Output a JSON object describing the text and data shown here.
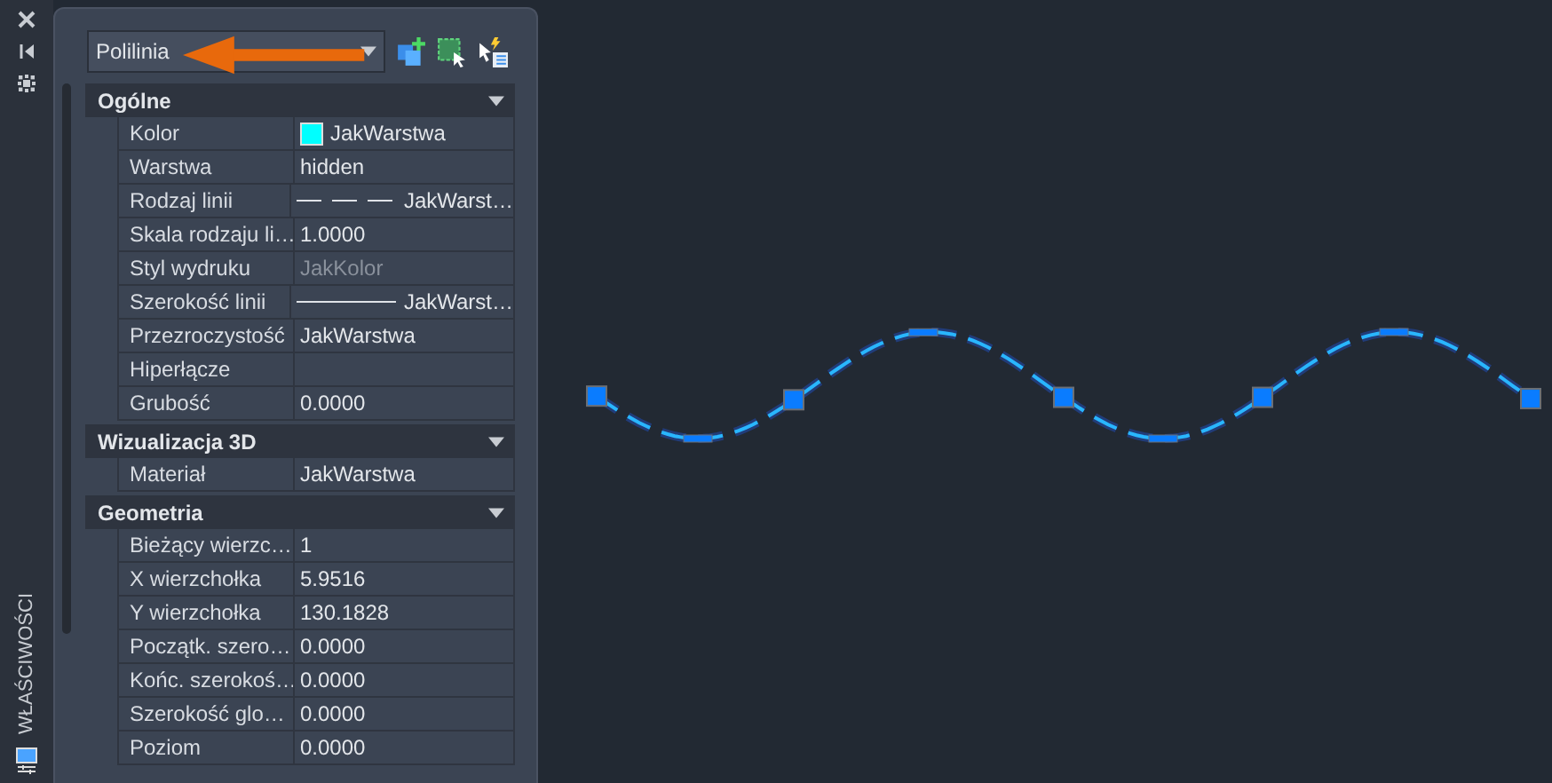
{
  "palette_title": "WŁAŚCIWOŚCI",
  "object_selector": {
    "value": "Polilinia"
  },
  "sections": [
    {
      "title": "Ogólne",
      "expanded": true,
      "rows": [
        {
          "label": "Kolor",
          "value": "JakWarstwa",
          "kind": "swatch",
          "color": "#00ffff",
          "disabled": false
        },
        {
          "label": "Warstwa",
          "value": "hidden",
          "kind": "text",
          "disabled": false
        },
        {
          "label": "Rodzaj linii",
          "value": "JakWarst…",
          "kind": "dashed",
          "disabled": false
        },
        {
          "label": "Skala rodzaju li…",
          "value": "1.0000",
          "kind": "text",
          "disabled": false
        },
        {
          "label": "Styl wydruku",
          "value": "JakKolor",
          "kind": "text",
          "disabled": true
        },
        {
          "label": "Szerokość linii",
          "value": "JakWarst…",
          "kind": "solid",
          "disabled": false
        },
        {
          "label": "Przezroczystość",
          "value": "JakWarstwa",
          "kind": "text",
          "disabled": false
        },
        {
          "label": "Hiperłącze",
          "value": "",
          "kind": "text",
          "disabled": false
        },
        {
          "label": "Grubość",
          "value": "0.0000",
          "kind": "text",
          "disabled": false
        }
      ]
    },
    {
      "title": "Wizualizacja 3D",
      "expanded": true,
      "rows": [
        {
          "label": "Materiał",
          "value": "JakWarstwa",
          "kind": "text",
          "disabled": false
        }
      ]
    },
    {
      "title": "Geometria",
      "expanded": true,
      "rows": [
        {
          "label": "Bieżący wierzc…",
          "value": "1",
          "kind": "text",
          "disabled": false
        },
        {
          "label": "X wierzchołka",
          "value": "5.9516",
          "kind": "text",
          "disabled": false
        },
        {
          "label": "Y wierzchołka",
          "value": "130.1828",
          "kind": "text",
          "disabled": false
        },
        {
          "label": "Początk. szero…",
          "value": "0.0000",
          "kind": "text",
          "disabled": false
        },
        {
          "label": "Końc. szerokoś…",
          "value": "0.0000",
          "kind": "text",
          "disabled": false
        },
        {
          "label": "Szerokość glo…",
          "value": "0.0000",
          "kind": "text",
          "disabled": false
        },
        {
          "label": "Poziom",
          "value": "0.0000",
          "kind": "text",
          "disabled": false
        }
      ]
    }
  ]
}
